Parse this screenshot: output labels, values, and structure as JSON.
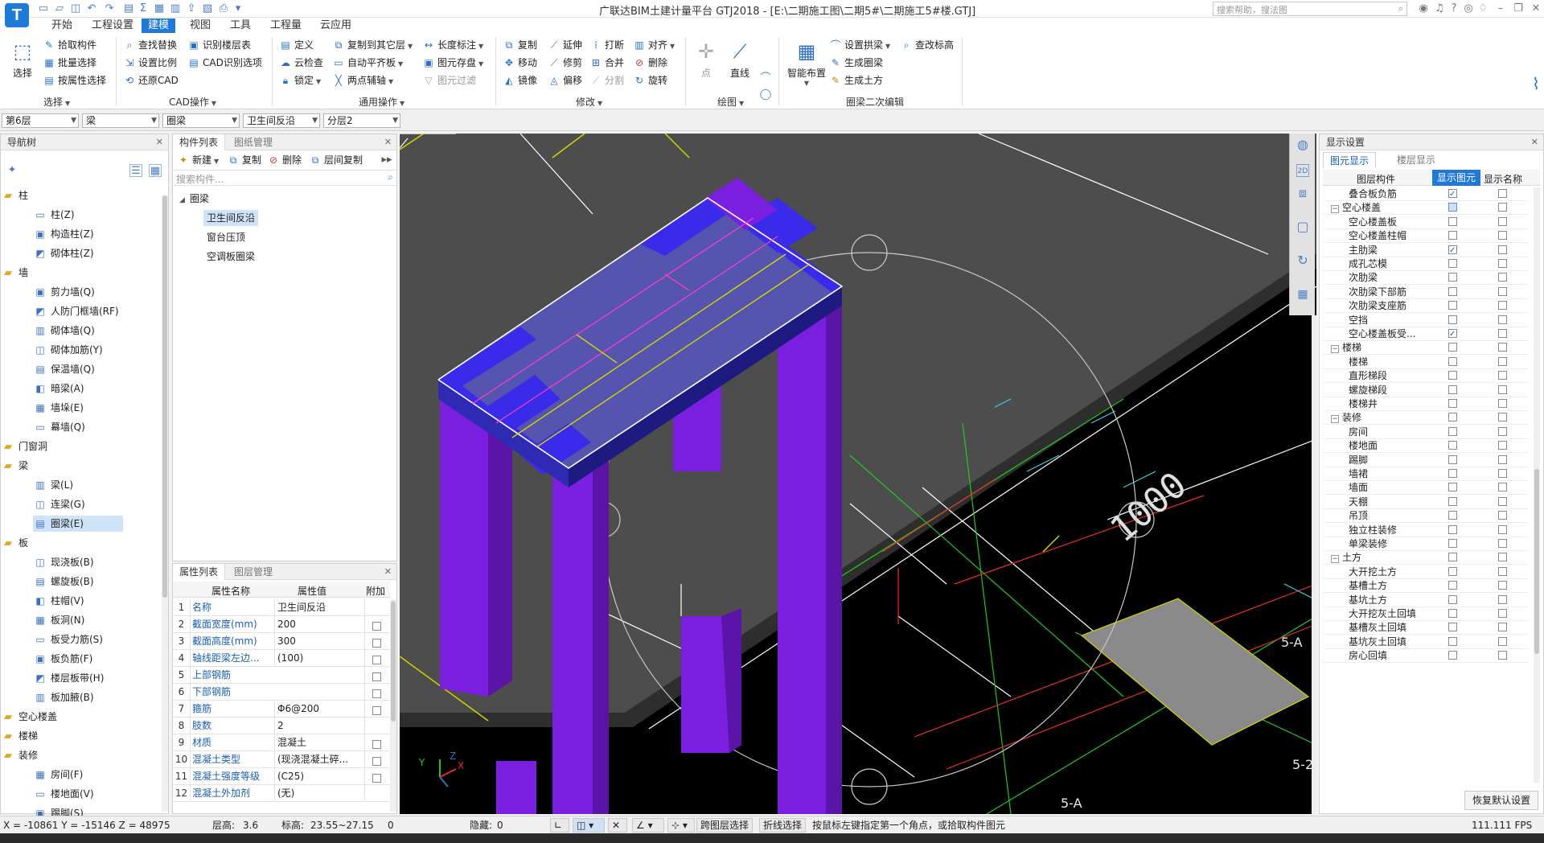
{
  "app": {
    "logo_letter": "T",
    "title": "广联达BIM土建计量平台 GTJ2018 - [E:\\二期施工图\\二期5#\\二期施工5#楼.GTJ]",
    "search_placeholder": "搜索帮助，搜法图"
  },
  "menu": {
    "tabs": [
      "开始",
      "工程设置",
      "建模",
      "视图",
      "工具",
      "工程量",
      "云应用"
    ],
    "active": "建模"
  },
  "ribbon": {
    "select": {
      "big_label": "选择",
      "buttons": [
        "拾取构件",
        "批量选择",
        "按属性选择"
      ],
      "group": "选择"
    },
    "cad": {
      "buttons": [
        "查找替换",
        "识别楼层表",
        "设置比例",
        "CAD识别选项",
        "还原CAD"
      ],
      "group": "CAD操作"
    },
    "common": {
      "buttons": [
        "定义",
        "复制到其它层",
        "长度标注",
        "云检查",
        "自动平齐板",
        "图元存盘",
        "锁定",
        "两点辅轴",
        "图元过滤"
      ],
      "group": "通用操作"
    },
    "modify": {
      "buttons": [
        "复制",
        "延伸",
        "打断",
        "对齐",
        "移动",
        "修剪",
        "合并",
        "删除",
        "镜像",
        "偏移",
        "分割",
        "旋转"
      ],
      "group": "修改"
    },
    "draw": {
      "point": "点",
      "line": "直线",
      "group": "绘图"
    },
    "ringbeam": {
      "smart": "智能布置",
      "buttons": [
        "设置拱梁",
        "查改标高",
        "生成圈梁",
        "生成土方"
      ],
      "group": "圈梁二次编辑"
    }
  },
  "selectors": [
    "第6层",
    "梁",
    "圈梁",
    "卫生间反沿",
    "分层2"
  ],
  "nav_tree": {
    "title": "导航树",
    "categories": [
      {
        "label": "柱",
        "items": [
          "柱(Z)",
          "构造柱(Z)",
          "砌体柱(Z)"
        ]
      },
      {
        "label": "墙",
        "items": [
          "剪力墙(Q)",
          "人防门框墙(RF)",
          "砌体墙(Q)",
          "砌体加筋(Y)",
          "保温墙(Q)",
          "暗梁(A)",
          "墙垛(E)",
          "幕墙(Q)"
        ]
      },
      {
        "label": "门窗洞",
        "items": []
      },
      {
        "label": "梁",
        "items": [
          "梁(L)",
          "连梁(G)",
          "圈梁(E)"
        ]
      },
      {
        "label": "板",
        "items": [
          "现浇板(B)",
          "螺旋板(B)",
          "柱帽(V)",
          "板洞(N)",
          "板受力筋(S)",
          "板负筋(F)",
          "楼层板带(H)",
          "板加腋(B)"
        ]
      },
      {
        "label": "空心楼盖",
        "items": []
      },
      {
        "label": "楼梯",
        "items": []
      },
      {
        "label": "装修",
        "items": [
          "房间(F)",
          "楼地面(V)",
          "踢脚(S)"
        ]
      }
    ],
    "selected": "圈梁(E)"
  },
  "component_list": {
    "tabs": [
      "构件列表",
      "图纸管理"
    ],
    "toolbar": [
      "新建",
      "复制",
      "删除",
      "层间复制"
    ],
    "search_placeholder": "搜索构件...",
    "group": "圈梁",
    "items": [
      "卫生间反沿",
      "窗台压顶",
      "空调板圈梁"
    ],
    "selected": "卫生间反沿"
  },
  "properties": {
    "tabs": [
      "属性列表",
      "图层管理"
    ],
    "headers": [
      "属性名称",
      "属性值",
      "附加"
    ],
    "rows": [
      {
        "n": "1",
        "name": "名称",
        "value": "卫生间反沿",
        "cb": false,
        "check": false
      },
      {
        "n": "2",
        "name": "截面宽度(mm)",
        "value": "200",
        "cb": true,
        "check": false
      },
      {
        "n": "3",
        "name": "截面高度(mm)",
        "value": "300",
        "cb": true,
        "check": false
      },
      {
        "n": "4",
        "name": "轴线距梁左边...",
        "value": "(100)",
        "cb": true,
        "check": false
      },
      {
        "n": "5",
        "name": "上部钢筋",
        "value": "",
        "cb": true,
        "check": false
      },
      {
        "n": "6",
        "name": "下部钢筋",
        "value": "",
        "cb": true,
        "check": false
      },
      {
        "n": "7",
        "name": "箍筋",
        "value": "Φ6@200",
        "cb": true,
        "check": false
      },
      {
        "n": "8",
        "name": "肢数",
        "value": "2",
        "cb": false,
        "check": false
      },
      {
        "n": "9",
        "name": "材质",
        "value": "混凝土",
        "cb": true,
        "check": false
      },
      {
        "n": "10",
        "name": "混凝土类型",
        "value": "(现浇混凝土碎...",
        "cb": true,
        "check": false
      },
      {
        "n": "11",
        "name": "混凝土强度等级",
        "value": "(C25)",
        "cb": true,
        "check": false
      },
      {
        "n": "12",
        "name": "混凝土外加剂",
        "value": "(无)",
        "cb": false,
        "check": false
      }
    ]
  },
  "display": {
    "title": "显示设置",
    "tabs": [
      "图元显示",
      "楼层显示"
    ],
    "headers": [
      "图层构件",
      "显示图元",
      "显示名称"
    ],
    "rows": [
      {
        "label": "叠合板负筋",
        "level": 1,
        "show": "checked",
        "name": false
      },
      {
        "label": "空心楼盖",
        "level": 0,
        "show": "partial",
        "name": false
      },
      {
        "label": "空心楼盖板",
        "level": 1,
        "show": "none",
        "name": false
      },
      {
        "label": "空心楼盖柱帽",
        "level": 1,
        "show": "none",
        "name": false
      },
      {
        "label": "主肋梁",
        "level": 1,
        "show": "checked",
        "name": false
      },
      {
        "label": "成孔芯模",
        "level": 1,
        "show": "none",
        "name": false
      },
      {
        "label": "次肋梁",
        "level": 1,
        "show": "none",
        "name": false
      },
      {
        "label": "次肋梁下部筋",
        "level": 1,
        "show": "none",
        "name": false
      },
      {
        "label": "次肋梁支座筋",
        "level": 1,
        "show": "none",
        "name": false
      },
      {
        "label": "空挡",
        "level": 1,
        "show": "none",
        "name": false
      },
      {
        "label": "空心楼盖板受...",
        "level": 1,
        "show": "checked",
        "name": false
      },
      {
        "label": "楼梯",
        "level": 0,
        "show": "none",
        "name": false
      },
      {
        "label": "楼梯",
        "level": 1,
        "show": "none",
        "name": false
      },
      {
        "label": "直形梯段",
        "level": 1,
        "show": "none",
        "name": false
      },
      {
        "label": "螺旋梯段",
        "level": 1,
        "show": "none",
        "name": false
      },
      {
        "label": "楼梯井",
        "level": 1,
        "show": "none",
        "name": false
      },
      {
        "label": "装修",
        "level": 0,
        "show": "none",
        "name": false
      },
      {
        "label": "房间",
        "level": 1,
        "show": "none",
        "name": false
      },
      {
        "label": "楼地面",
        "level": 1,
        "show": "none",
        "name": false
      },
      {
        "label": "踢脚",
        "level": 1,
        "show": "none",
        "name": false
      },
      {
        "label": "墙裙",
        "level": 1,
        "show": "none",
        "name": false
      },
      {
        "label": "墙面",
        "level": 1,
        "show": "none",
        "name": false
      },
      {
        "label": "天棚",
        "level": 1,
        "show": "none",
        "name": false
      },
      {
        "label": "吊顶",
        "level": 1,
        "show": "none",
        "name": false
      },
      {
        "label": "独立柱装修",
        "level": 1,
        "show": "none",
        "name": false
      },
      {
        "label": "单梁装修",
        "level": 1,
        "show": "none",
        "name": false
      },
      {
        "label": "土方",
        "level": 0,
        "show": "none",
        "name": false
      },
      {
        "label": "大开挖土方",
        "level": 1,
        "show": "none",
        "name": false
      },
      {
        "label": "基槽土方",
        "level": 1,
        "show": "none",
        "name": false
      },
      {
        "label": "基坑土方",
        "level": 1,
        "show": "none",
        "name": false
      },
      {
        "label": "大开挖灰土回填",
        "level": 1,
        "show": "none",
        "name": false
      },
      {
        "label": "基槽灰土回填",
        "level": 1,
        "show": "none",
        "name": false
      },
      {
        "label": "基坑灰土回填",
        "level": 1,
        "show": "none",
        "name": false
      },
      {
        "label": "房心回填",
        "level": 1,
        "show": "none",
        "name": false
      }
    ],
    "restore_button": "恢复默认设置"
  },
  "viewport": {
    "axis_labels": [
      "5-A",
      "5-A",
      "5-2"
    ],
    "dim_text": "1000",
    "view_indicator": "2D"
  },
  "status": {
    "coords": "X = -10861 Y = -15146 Z = 48975",
    "floor_height_label": "层高:",
    "floor_height": "3.6",
    "elevation_label": "标高:",
    "elevation": "23.55~27.15",
    "zero": "0",
    "hidden_label": "隐藏:",
    "hidden": "0",
    "btn_cross_layer": "跨图层选择",
    "btn_polyline": "折线选择",
    "hint": "按鼠标左键指定第一个角点，或拾取构件图元",
    "fps": "111.111 FPS"
  },
  "colors": {
    "accent": "#1e7ad6",
    "beam_purple": "#7a1fe0",
    "beam_blue": "#3a2bea",
    "slab": "#4d4d4d",
    "viewport_bg": "#000000"
  }
}
